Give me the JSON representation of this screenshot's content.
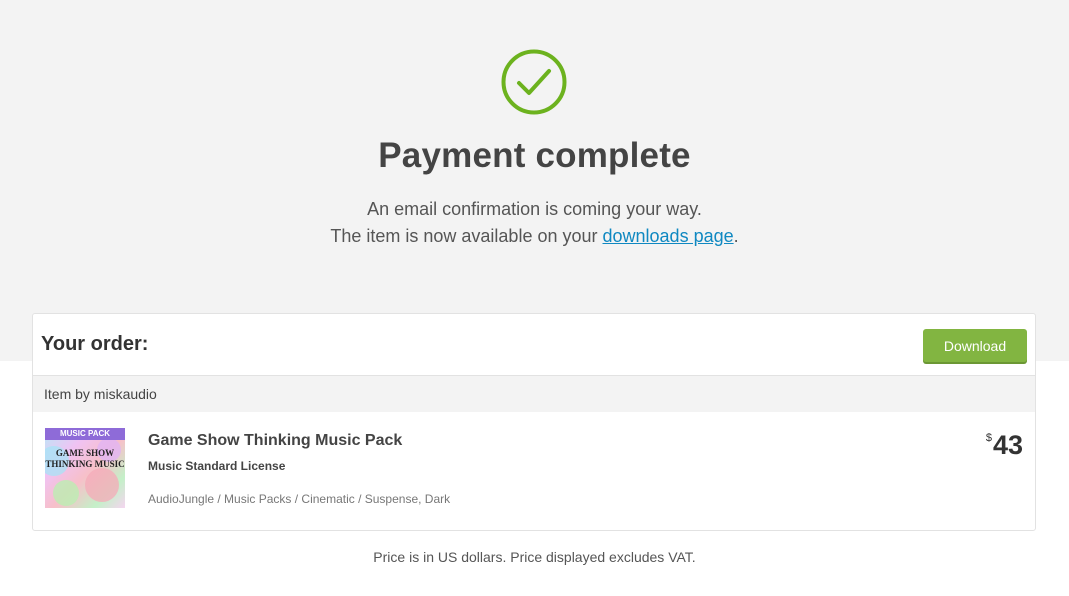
{
  "header": {
    "title": "Payment complete",
    "line1": "An email confirmation is coming your way.",
    "line2_prefix": "The item is now available on your ",
    "line2_link": "downloads page",
    "line2_suffix": "."
  },
  "order": {
    "heading": "Your order:",
    "download_label": "Download",
    "author_label": "Item by miskaudio",
    "item": {
      "title": "Game Show Thinking Music Pack",
      "license": "Music Standard License",
      "categories": "AudioJungle / Music Packs / Cinematic / Suspense, Dark",
      "currency_symbol": "$",
      "price": "43",
      "thumbnail": {
        "banner": "MUSIC PACK",
        "line1": "GAME SHOW",
        "line2": "THINKING MUSIC"
      }
    }
  },
  "footnote": "Price is in US dollars. Price displayed excludes VAT.",
  "colors": {
    "accent_green": "#82b541",
    "check_green": "#6cb21e",
    "link_blue": "#0f88c1",
    "hero_background": "#f3f3f3"
  },
  "icons": {
    "success": "check-circle-icon"
  }
}
